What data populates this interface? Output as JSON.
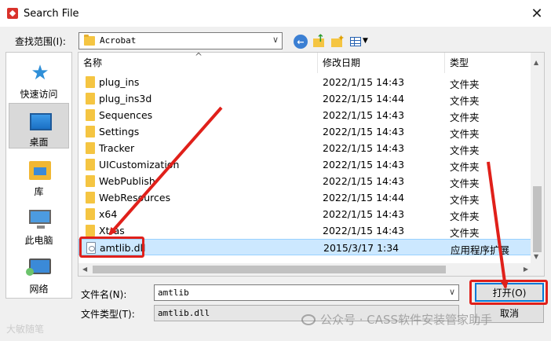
{
  "window": {
    "title": "Search File",
    "close_glyph": "✕"
  },
  "lookin": {
    "label": "查找范围(I):",
    "value": "Acrobat",
    "arrow": "∨"
  },
  "toolbar": {
    "back_glyph": "←",
    "up_glyph": "↑",
    "new_folder_glyph": "✦",
    "view_dropdown_glyph": "▼"
  },
  "places": [
    {
      "label": "快速访问",
      "icon": "star-icon"
    },
    {
      "label": "桌面",
      "icon": "desktop-icon"
    },
    {
      "label": "库",
      "icon": "library-icon"
    },
    {
      "label": "此电脑",
      "icon": "computer-icon"
    },
    {
      "label": "网络",
      "icon": "network-icon"
    }
  ],
  "columns": {
    "name": "名称",
    "date": "修改日期",
    "type": "类型",
    "sort_glyph": "^"
  },
  "files": [
    {
      "name": "plug_ins",
      "date": "2022/1/15 14:43",
      "type": "文件夹",
      "kind": "folder"
    },
    {
      "name": "plug_ins3d",
      "date": "2022/1/15 14:44",
      "type": "文件夹",
      "kind": "folder"
    },
    {
      "name": "Sequences",
      "date": "2022/1/15 14:43",
      "type": "文件夹",
      "kind": "folder"
    },
    {
      "name": "Settings",
      "date": "2022/1/15 14:43",
      "type": "文件夹",
      "kind": "folder"
    },
    {
      "name": "Tracker",
      "date": "2022/1/15 14:43",
      "type": "文件夹",
      "kind": "folder"
    },
    {
      "name": "UICustomization",
      "date": "2022/1/15 14:43",
      "type": "文件夹",
      "kind": "folder"
    },
    {
      "name": "WebPublish",
      "date": "2022/1/15 14:43",
      "type": "文件夹",
      "kind": "folder"
    },
    {
      "name": "WebResources",
      "date": "2022/1/15 14:44",
      "type": "文件夹",
      "kind": "folder"
    },
    {
      "name": "x64",
      "date": "2022/1/15 14:43",
      "type": "文件夹",
      "kind": "folder"
    },
    {
      "name": "Xtras",
      "date": "2022/1/15 14:43",
      "type": "文件夹",
      "kind": "folder"
    },
    {
      "name": "amtlib.dll",
      "date": "2015/3/17 1:34",
      "type": "应用程序扩展",
      "kind": "file",
      "selected": true
    }
  ],
  "scroll": {
    "up": "▲",
    "down": "▼",
    "left": "◀",
    "right": "▶"
  },
  "filename": {
    "label": "文件名(N):",
    "value": "amtlib",
    "arrow": "∨"
  },
  "filetype": {
    "label": "文件类型(T):",
    "value": "amtlib.dll"
  },
  "buttons": {
    "open": "打开(O)",
    "cancel": "取消"
  },
  "annotation_color": "#e0201a",
  "watermark": {
    "left": "大敏随笔",
    "right": "公众号 · CASS软件安装管家助手"
  }
}
